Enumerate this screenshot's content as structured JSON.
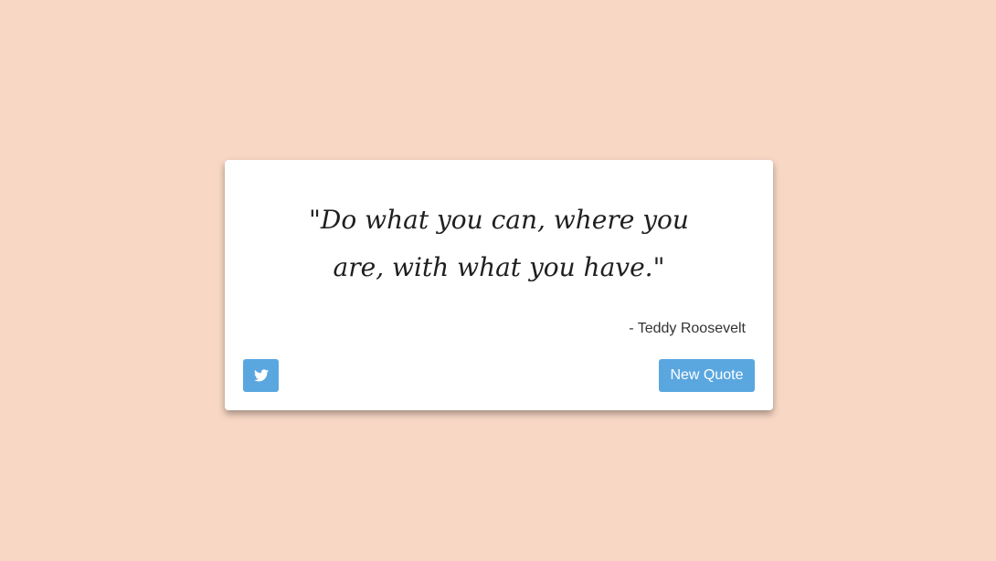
{
  "quote": {
    "text": "\"Do what you can, where you are, with what you have.\"",
    "author": "- Teddy Roosevelt"
  },
  "buttons": {
    "tweet_icon": "twitter-icon",
    "new_quote_label": "New Quote"
  },
  "colors": {
    "background": "#f8d7c5",
    "card": "#ffffff",
    "accent": "#5aa7e0"
  }
}
